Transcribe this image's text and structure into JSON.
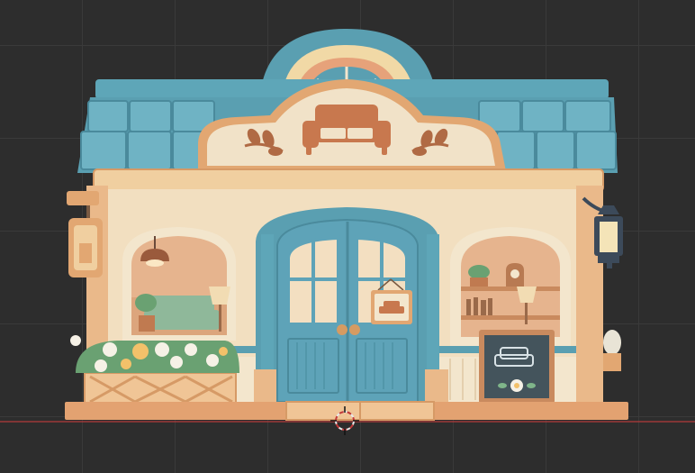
{
  "viewport": {
    "background": "#2d2d2d",
    "grid_color": "#3a3a3a",
    "horizon_color": "#b33b3b"
  },
  "scene": {
    "subject": "furniture-shop",
    "sign_icon": "sofa-icon",
    "door_sign_icon": "sofa-icon",
    "chalkboard_icon": "sofa-icon",
    "colors": {
      "roof": "#5a9fb1",
      "roof_dark": "#4a8a9c",
      "wall": "#f2dfc0",
      "trim": "#e2a772",
      "door": "#5ea3b8",
      "sign": "#f1e2c8",
      "sign_icon": "#c8784e",
      "awning_cream": "#f3e6cd",
      "awning_peach": "#eebd8f"
    }
  },
  "tools": {
    "cursor_icon": "3d-cursor-icon"
  }
}
